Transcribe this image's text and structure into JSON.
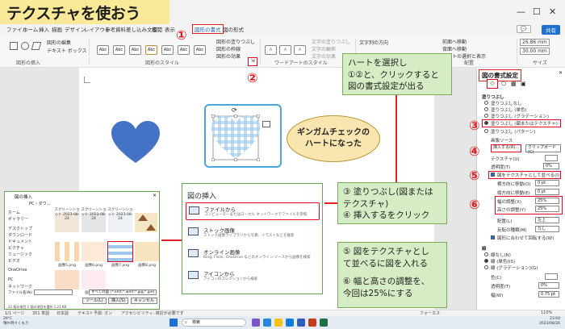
{
  "title": "テクスチャを使おう",
  "menu_tabs": [
    "ファイル",
    "ホーム",
    "挿入",
    "描画",
    "デザイン",
    "レイアウト",
    "参考資料",
    "差し込み文書",
    "校閲",
    "表示",
    "図形の書式",
    "図の形式"
  ],
  "menu_active": "図形の書式",
  "share_label": "共有",
  "ribbon": {
    "insert_shapes_label": "図形の挿入",
    "edit_shape": "図形の編集",
    "text_box": "テキスト ボックス",
    "styles_label": "図形のスタイル",
    "style_sample": "Abc",
    "fill": "図形の塗りつぶし",
    "outline": "図形の枠線",
    "effects": "図形の効果",
    "wordart_label": "ワードアートのスタイル",
    "text_fill": "文字の塗りつぶし",
    "text_outline": "文字の輪郭",
    "text_effects": "文字の効果",
    "text_direction": "文字列の方向",
    "arrange_label": "配置",
    "forward": "前面へ移動",
    "backward": "背面へ移動",
    "selection_pane": "オブジェクトの選択と表示",
    "size_label": "サイズ",
    "height": "26.86 mm",
    "width": "30.00 mm"
  },
  "circled_numbers": [
    "①",
    "②",
    "③",
    "④",
    "⑤",
    "⑥"
  ],
  "callout_top": {
    "line1": "ハートを選択し",
    "line2": "①②と、クリックすると",
    "line3": "図の書式設定が出る"
  },
  "callout_heart": {
    "line1": "ギンガムチェックの",
    "line2": "ハートになった"
  },
  "callout_fill": {
    "line1": "③ 塗りつぶし(図または",
    "line2": "テクスチャ)",
    "line3": "④ 挿入するをクリック"
  },
  "callout_tile": {
    "line1": "⑤ 図をテクスチャとし",
    "line2": "て並べるに図を入れる",
    "line3": "⑥ 幅と高さの調整を、",
    "line4": "今回は25%にする"
  },
  "insert_menu": {
    "title": "図の挿入",
    "items": [
      {
        "label": "ファイルから",
        "sub": "コンピューターまたはローカル ネットワークでファイルを参照"
      },
      {
        "label": "ストック画像",
        "sub": "ストック画像ライブラリから写真、イラストなどを検索"
      },
      {
        "label": "オンライン画像",
        "sub": "Bing, Flickr, OneDrive などのオンライン ソースから画像を検索"
      },
      {
        "label": "アイコンから",
        "sub": "アイコンのコレクションから検索"
      }
    ]
  },
  "format_pane": {
    "title": "図の書式設定",
    "fill_section": "塗りつぶし",
    "options": [
      "塗りつぶしなし",
      "塗りつぶし (単色)",
      "塗りつぶし (グラデーション)",
      "塗りつぶし (図またはテクスチャ)",
      "塗りつぶし (パターン)"
    ],
    "picture_source": "画像ソース",
    "insert_btn": "挿入する(R)...",
    "clipboard_btn": "クリップボード(C)",
    "texture": "テクスチャ(U)",
    "transparency": "透明度(T)",
    "transparency_val": "0%",
    "tile_check": "図をテクスチャとして並べる(I)",
    "offset_x": "横方向に移動(O)",
    "offset_x_val": "0 pt",
    "offset_y": "縦方向に移動(E)",
    "offset_y_val": "0 pt",
    "scale_x": "幅の調整(X)",
    "scale_x_val": "25%",
    "scale_y": "高さの調整(Y)",
    "scale_y_val": "25%",
    "alignment": "配置(L)",
    "alignment_val": "左上",
    "mirror": "反転の種類(M)",
    "mirror_val": "なし",
    "rotate_with_shape": "図形に合わせて回転する(W)",
    "line_section": "線",
    "line_opts": [
      "線なし(N)",
      "線 (単色)(S)",
      "線 (グラデーション)(G)"
    ],
    "color": "色(C)",
    "line_transparency": "透明度(T)",
    "line_transparency_val": "0%",
    "line_width": "幅(W)",
    "line_width_val": "0.75 pt"
  },
  "explorer": {
    "title": "図の挿入",
    "breadcrumb": "PC › ダウ...",
    "sidebar": [
      "ホーム",
      "ギャラリー",
      "デスクトップ",
      "ダウンロード",
      "ドキュメント",
      "ピクチャ",
      "ミュージック",
      "ビデオ",
      "OneDrive",
      "PC",
      "ネットワーク"
    ],
    "thumbs": [
      {
        "label": "スクリーンショット 2023-08-24"
      },
      {
        "label": "スクリーンショット 2023-08-24"
      },
      {
        "label": "スクリーンショット 2023-08-24"
      },
      {
        "label": "画像5.png"
      },
      {
        "label": "画像6.png"
      },
      {
        "label": "画像7.png"
      },
      {
        "label": "画像8.png"
      },
      {
        "label": "画像9.png"
      }
    ],
    "filename_label": "ファイル名(N):",
    "filetype": "すべての図 (*.emf;*.wmf;*.jpg;*.jpe)",
    "tools": "ツール(L)",
    "insert": "挿入(S)",
    "cancel": "キャンセル",
    "status": "22 個の項目   1 個の項目を選択  1.21 KB"
  },
  "statusbar": {
    "page": "1/1 ページ",
    "words": "351 単語",
    "lang": "日本語",
    "prediction": "テキスト予測: オン",
    "accessibility": "アクセシビリティ: 検討が必要です",
    "focus": "フォーカス",
    "zoom": "110%"
  },
  "taskbar": {
    "weather_temp": "29°C",
    "weather_desc": "晴れ時々くもり",
    "search": "検索",
    "time": "23:04",
    "date": "2023/08/26"
  },
  "colors": {
    "accent_blue": "#4472c4",
    "gingham": "#9cc8ec",
    "callout_green": "#d6ecc5",
    "callout_tan": "#f8e5b0",
    "red": "#e01b1b"
  }
}
